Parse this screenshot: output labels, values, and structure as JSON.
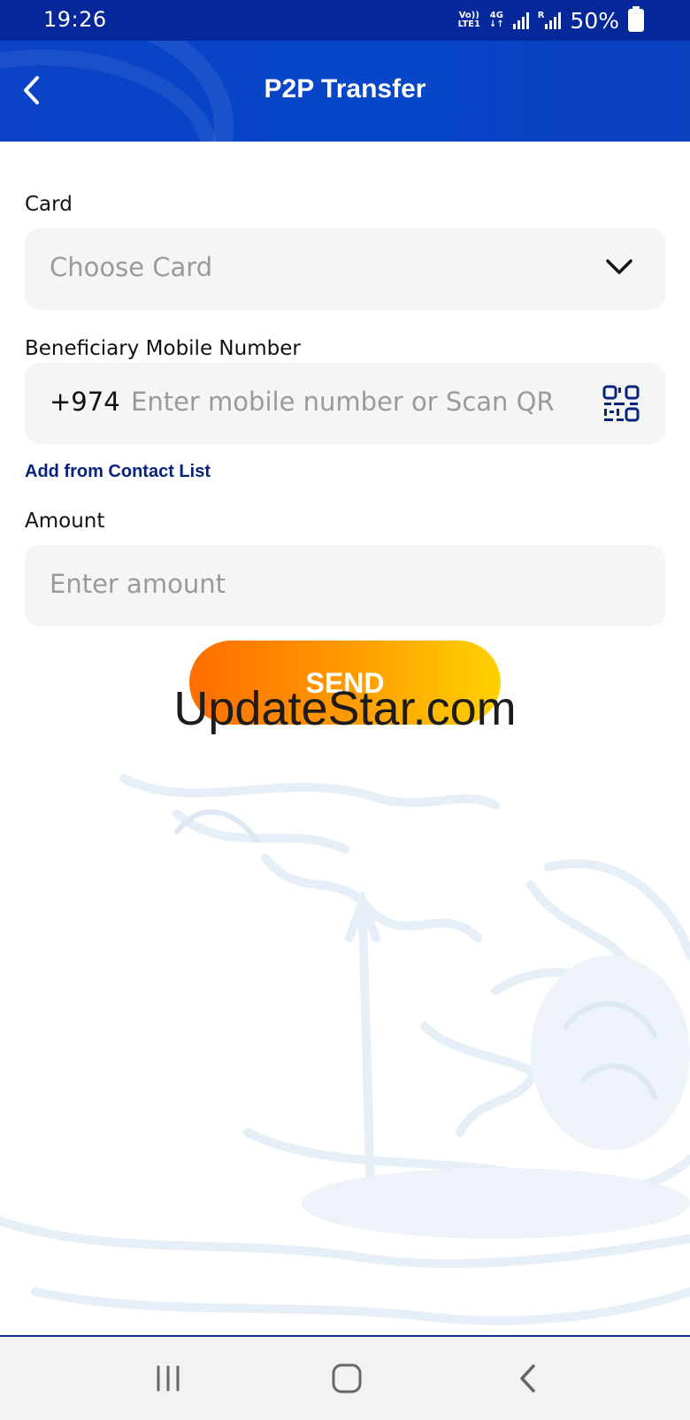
{
  "status_bar": {
    "time": "19:26",
    "volte_label": "Vo))",
    "lte_label": "LTE1",
    "network_label": "4G",
    "roaming_label": "R",
    "battery": "50%"
  },
  "header": {
    "title": "P2P Transfer",
    "back_icon": "chevron-left-icon"
  },
  "form": {
    "card_label": "Card",
    "card_placeholder": "Choose Card",
    "mobile_label": "Beneficiary Mobile Number",
    "country_code": "+974",
    "mobile_placeholder": "Enter mobile number or Scan QR",
    "contact_link": "Add from Contact List",
    "amount_label": "Amount",
    "amount_placeholder": "Enter amount",
    "send_label": "SEND"
  },
  "watermark": "UpdateStar.com",
  "colors": {
    "brand_blue": "#0646c8",
    "status_blue": "#04279a",
    "link_blue": "#08237e",
    "send_gradient_start": "#ff6d00",
    "send_gradient_end": "#ffd200"
  },
  "nav": {
    "recent_icon": "recent-apps-icon",
    "home_icon": "home-icon",
    "back_icon": "back-icon"
  }
}
